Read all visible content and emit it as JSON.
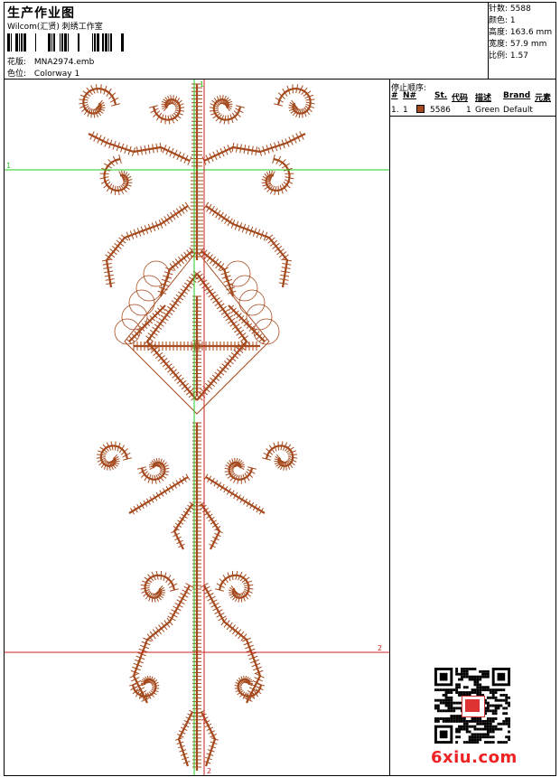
{
  "header": {
    "title": "生产作业图",
    "subtitle": "Wilcom(汇贤) 刺绣工作室",
    "design_label": "花版:",
    "design_file": "MNA2974.emb",
    "colorway_label": "色位:",
    "colorway": "Colorway 1"
  },
  "stats": [
    {
      "label": "针数:",
      "value": "5588"
    },
    {
      "label": "颜色:",
      "value": "1"
    },
    {
      "label": "高度:",
      "value": "163.6 mm"
    },
    {
      "label": "宽度:",
      "value": "57.9 mm"
    },
    {
      "label": "比例:",
      "value": "1.57"
    }
  ],
  "stop_sequence": {
    "title": "停止顺序:",
    "columns": [
      "#",
      "N#",
      "St.",
      "代码",
      "描述",
      "Brand",
      "元素"
    ],
    "rows": [
      {
        "index": "1.",
        "needle": "1",
        "stitches": "5586",
        "code": "1",
        "description": "Green",
        "brand": "Default",
        "element": "",
        "color": "#a54a1e"
      }
    ]
  },
  "guides": [
    {
      "label": "1",
      "color": "#22cc22"
    },
    {
      "label": "2",
      "color": "#cc2222"
    }
  ],
  "thread_color": "#a54a1e",
  "watermark": "6xiu.com"
}
